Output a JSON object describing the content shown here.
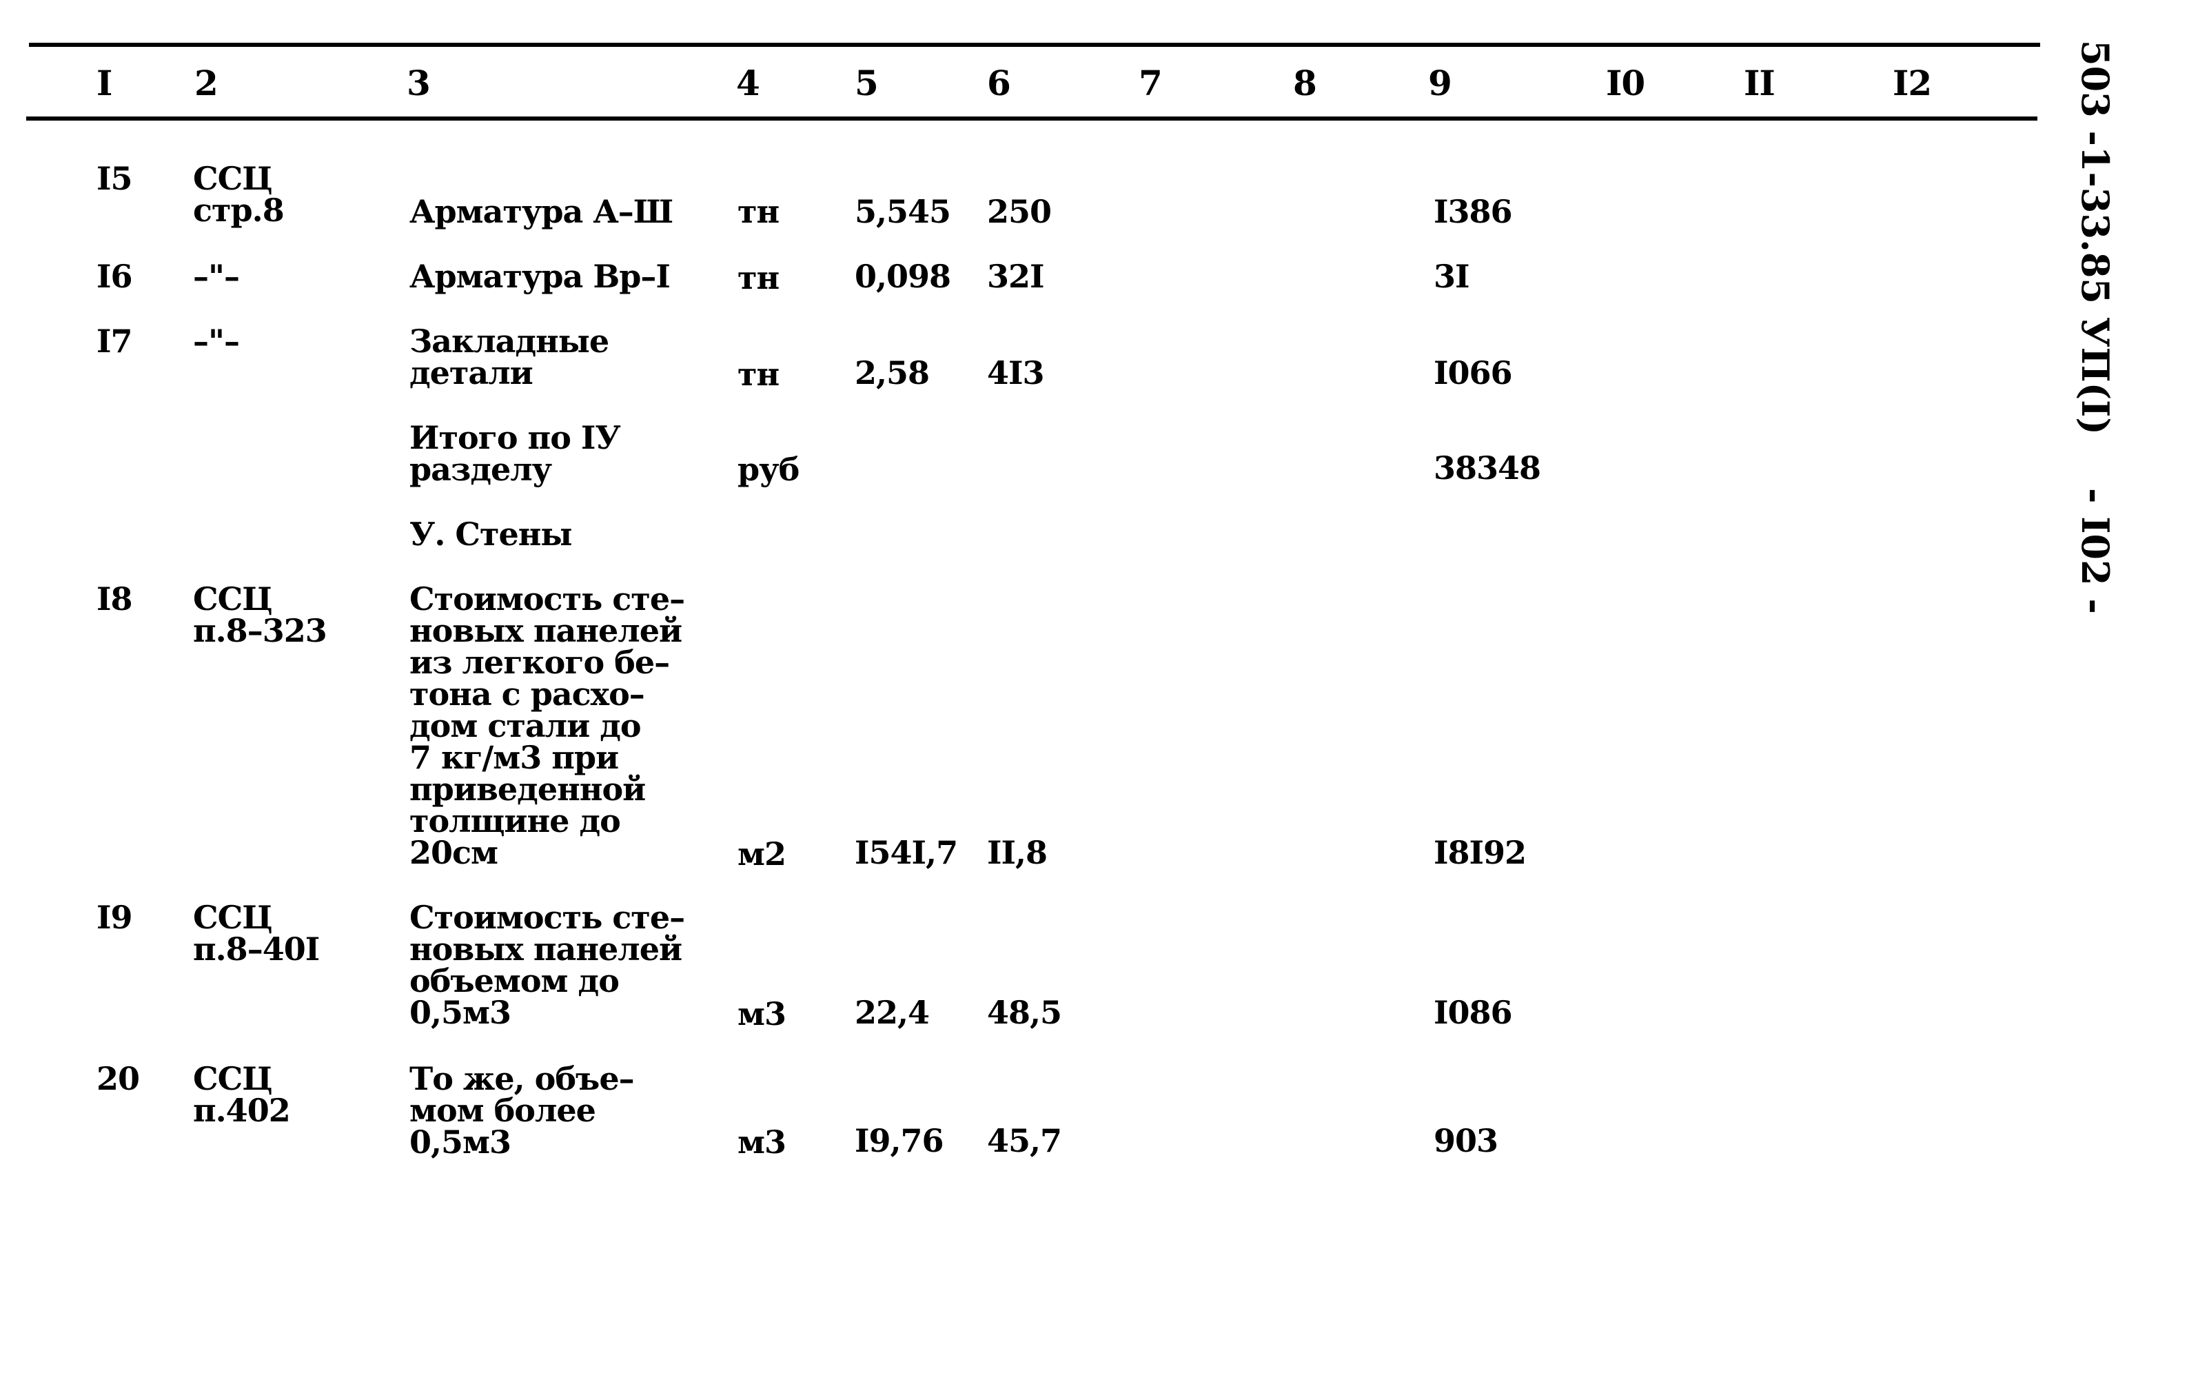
{
  "header": {
    "columns": [
      "I",
      "2",
      "3",
      "4",
      "5",
      "6",
      "7",
      "8",
      "9",
      "I0",
      "II",
      "I2"
    ]
  },
  "side_text": {
    "doc_code": "503 -1-33.85 УП(I)",
    "page_number": "- I02 -"
  },
  "rows": [
    {
      "no": "I5",
      "ref": "ССЦ\nстр.8",
      "name": "Арматура А–Ш",
      "unit": "тн",
      "qty": "5,545",
      "price": "250",
      "total": "I386"
    },
    {
      "no": "I6",
      "ref": "–\"–",
      "name": "Арматура Вр–I",
      "unit": "тн",
      "qty": "0,098",
      "price": "32I",
      "total": "3I"
    },
    {
      "no": "I7",
      "ref": "–\"–",
      "name": "Закладные\nдетали",
      "unit": "тн",
      "qty": "2,58",
      "price": "4I3",
      "total": "I066"
    },
    {
      "no": "",
      "ref": "",
      "name": "Итого по IУ\nразделу",
      "unit": "руб",
      "qty": "",
      "price": "",
      "total": "38348"
    },
    {
      "no": "",
      "ref": "",
      "name": "У. Стены",
      "unit": "",
      "qty": "",
      "price": "",
      "total": ""
    },
    {
      "no": "I8",
      "ref": "ССЦ\nп.8–323",
      "name": "Стоимость сте–\nновых панелей\nиз легкого бе–\nтона с расхо–\nдом стали до\n7 кг/м3 при\nприведенной\nтолщине до\n20см",
      "unit": "м2",
      "qty": "I54I,7",
      "price": "II,8",
      "total": "I8I92"
    },
    {
      "no": "I9",
      "ref": "ССЦ\nп.8–40I",
      "name": "Стоимость сте–\nновых панелей\nобъемом до\n0,5м3",
      "unit": "м3",
      "qty": "22,4",
      "price": "48,5",
      "total": "I086"
    },
    {
      "no": "20",
      "ref": "ССЦ\nп.402",
      "name": "То же, объе–\nмом более\n0,5м3",
      "unit": "м3",
      "qty": "I9,76",
      "price": "45,7",
      "total": "903"
    }
  ]
}
